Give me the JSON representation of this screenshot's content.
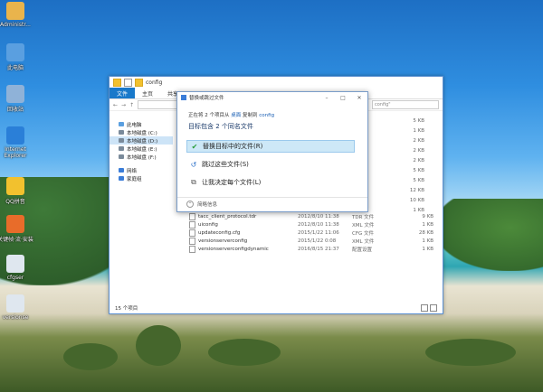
{
  "desktop_icons": [
    {
      "label": "Administr...",
      "glyph": "user-folder-icon",
      "color": "#e9b44c"
    },
    {
      "label": "此电脑",
      "glyph": "computer-icon",
      "color": "#5a9fe0"
    },
    {
      "label": "回收站",
      "glyph": "recycle-bin-icon",
      "color": "#8fb2d8"
    },
    {
      "label": "Internet Explorer",
      "glyph": "ie-icon",
      "color": "#2a7fd8"
    },
    {
      "label": "QQ拼音",
      "glyph": "qq-icon",
      "color": "#f2c12e"
    },
    {
      "label": "关键帧·流·安装",
      "glyph": "installer-icon",
      "color": "#e86c2a"
    },
    {
      "label": "cfgser",
      "glyph": "config-file-icon",
      "color": "#dfe7ef"
    },
    {
      "label": "versionse",
      "glyph": "config-file-icon",
      "color": "#dfe7ef"
    }
  ],
  "explorer": {
    "title": "config",
    "ribbon_tabs": [
      "文件",
      "主页",
      "共享"
    ],
    "search_placeholder": "config\"",
    "nav": [
      {
        "label": "此电脑",
        "kind": "pc"
      },
      {
        "label": "本地磁盘 (C:)",
        "kind": "drive"
      },
      {
        "label": "本地磁盘 (D:)",
        "kind": "drive",
        "selected": true
      },
      {
        "label": "本地磁盘 (E:)",
        "kind": "drive"
      },
      {
        "label": "本地磁盘 (F:)",
        "kind": "drive"
      },
      {
        "label": "网络",
        "kind": "net"
      },
      {
        "label": "家庭组",
        "kind": "home"
      }
    ],
    "sizes_top": [
      "5 KB",
      "1 KB",
      "2 KB",
      "2 KB",
      "2 KB",
      "5 KB",
      "5 KB",
      "12 KB",
      "10 KB",
      "1 KB"
    ],
    "files": [
      {
        "name": "tacc_client_protocol.tdr",
        "date": "2012/8/10 11:38",
        "type": "TDR 文件",
        "size": "9 KB"
      },
      {
        "name": "uiconfig",
        "date": "2012/8/10 11:38",
        "type": "XML 文件",
        "size": "1 KB"
      },
      {
        "name": "updateconfig.cfg",
        "date": "2015/1/22 11:06",
        "type": "CFG 文件",
        "size": "28 KB"
      },
      {
        "name": "versionserverconfig",
        "date": "2015/1/22 0:08",
        "type": "XML 文件",
        "size": "1 KB"
      },
      {
        "name": "versionserverconfigdynamic",
        "date": "2016/8/15 21:37",
        "type": "配置设置",
        "size": "1 KB"
      }
    ],
    "status": "15 个项目"
  },
  "dialog": {
    "title": "替换或跳过文件",
    "line_prefix": "正在将 2 个项目从 ",
    "line_src": "桌面",
    "line_mid": " 复制到 ",
    "line_dst": "config",
    "heading": "目标包含 2 个同名文件",
    "options": [
      {
        "label": "替换目标中的文件(R)",
        "icon": "✔",
        "color": "#2a9d3a",
        "selected": true
      },
      {
        "label": "跳过这些文件(S)",
        "icon": "↺",
        "color": "#2a6fc8",
        "selected": false
      },
      {
        "label": "让我决定每个文件(L)",
        "icon": "⧉",
        "color": "#555555",
        "selected": false
      }
    ],
    "more_label": "简略信息"
  }
}
